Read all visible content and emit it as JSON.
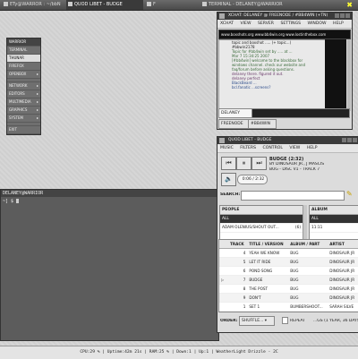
{
  "taskbar": {
    "tasks": [
      {
        "label": "ETy@WARROR : ~/bbN"
      },
      {
        "label": "QUOD LIBET - BUDGE"
      },
      {
        "label": "F"
      },
      {
        "label": "TERMINAL - DELANEY@WARRIOR"
      }
    ],
    "close_glyph": "✖"
  },
  "menu": {
    "title": "WARRIOR",
    "items": [
      "TERMINAL",
      "THUNAR",
      "FIREFOX",
      "OPENBOX",
      "NETWORK",
      "EDITORS",
      "MULTIMEDIA",
      "GRAPHICS",
      "SYSTEM",
      "EXIT"
    ],
    "selected": "THUNAR"
  },
  "terminal": {
    "title": "DELANEY@WARRIOR",
    "prompt": "~] $"
  },
  "irc": {
    "title": "XCHAT: DELANEY @ FREENODE / #BB4WIN (+TN)",
    "menus": [
      "XCHAT",
      "VIEW",
      "SERVER",
      "SETTINGS",
      "WINDOW",
      "HELP"
    ],
    "topic": "www.boxshots.org  www.bb4win.org  www.lostinthebox.com",
    "chat": [
      "topic and boxshot ..... (+ topic...)",
      "#bbwin2178",
      "Topic for #bb4win set by ..... at ...",
      "Mar 7 15:34:25 2007",
      "[#bb4win] welcome to the blackbox for",
      "windows channel. check our website and",
      "faq/forum before asking questions.",
      "delaney  there. figured it out.",
      "delaney  perfect",
      "BlackBeard  ...",
      "bcl.fanatic  ...screens?"
    ],
    "nick": "DELANEY",
    "network_tab": "FREENODE",
    "channel_tab": "#BB4WIN"
  },
  "music": {
    "title": "QUOD LIBET - BUDGE",
    "menus": [
      "MUSIC",
      "FILTERS",
      "CONTROL",
      "VIEW",
      "HELP"
    ],
    "now_playing": {
      "title": "BUDGE (2:32)",
      "by": "BY DINOSAUR JR., J MASCIS",
      "album": "BUG - DISC V1 - TRACK 7",
      "position": "0:06 / 2:32"
    },
    "search_label": "SEARCH:",
    "people": {
      "header": "PEOPLE",
      "rows": [
        {
          "name": "ALL",
          "count": ""
        },
        {
          "name": "ADAM OLENIUS/SHOUT OUT...",
          "count": "(6)"
        }
      ]
    },
    "albums": {
      "header": "ALBUM",
      "rows": [
        "ALL",
        "11:11"
      ]
    },
    "tracks": {
      "headers": [
        "TRACK",
        "TITLE / VERSION",
        "ALBUM / PART",
        "ARTIST"
      ],
      "rows": [
        {
          "track": "4",
          "title": "YEAH WE KNOW",
          "album": "BUG",
          "artist": "DINOSAUR JR"
        },
        {
          "track": "5",
          "title": "LET IT RIDE",
          "album": "BUG",
          "artist": "DINOSAUR JR"
        },
        {
          "track": "6",
          "title": "POND SONG",
          "album": "BUG",
          "artist": "DINOSAUR JR"
        },
        {
          "track": "7",
          "title": "BUDGE",
          "album": "BUG",
          "artist": "DINOSAUR JR"
        },
        {
          "track": "8",
          "title": "THE POST",
          "album": "BUG",
          "artist": "DINOSAUR JR"
        },
        {
          "track": "9",
          "title": "DON'T",
          "album": "BUG",
          "artist": "DINOSAUR JR"
        },
        {
          "track": "1",
          "title": "SET 1",
          "album": "BUMBERSHOOT...",
          "artist": "SARAH SILVE"
        }
      ],
      "playing_index": 3
    },
    "order_label": "ORDER:",
    "order_value": "SHUFFLE...",
    "repeat_label": "REPEAT",
    "summary": "...GS (1 YEAR, 36 DAYS"
  },
  "statusbar": {
    "text": "CPU:29 %  |  Uptime:42m 21s  |  RAM:25 %  |  Down:1  |  Up:1  |  WeatherLight Drizzle - 2C"
  }
}
